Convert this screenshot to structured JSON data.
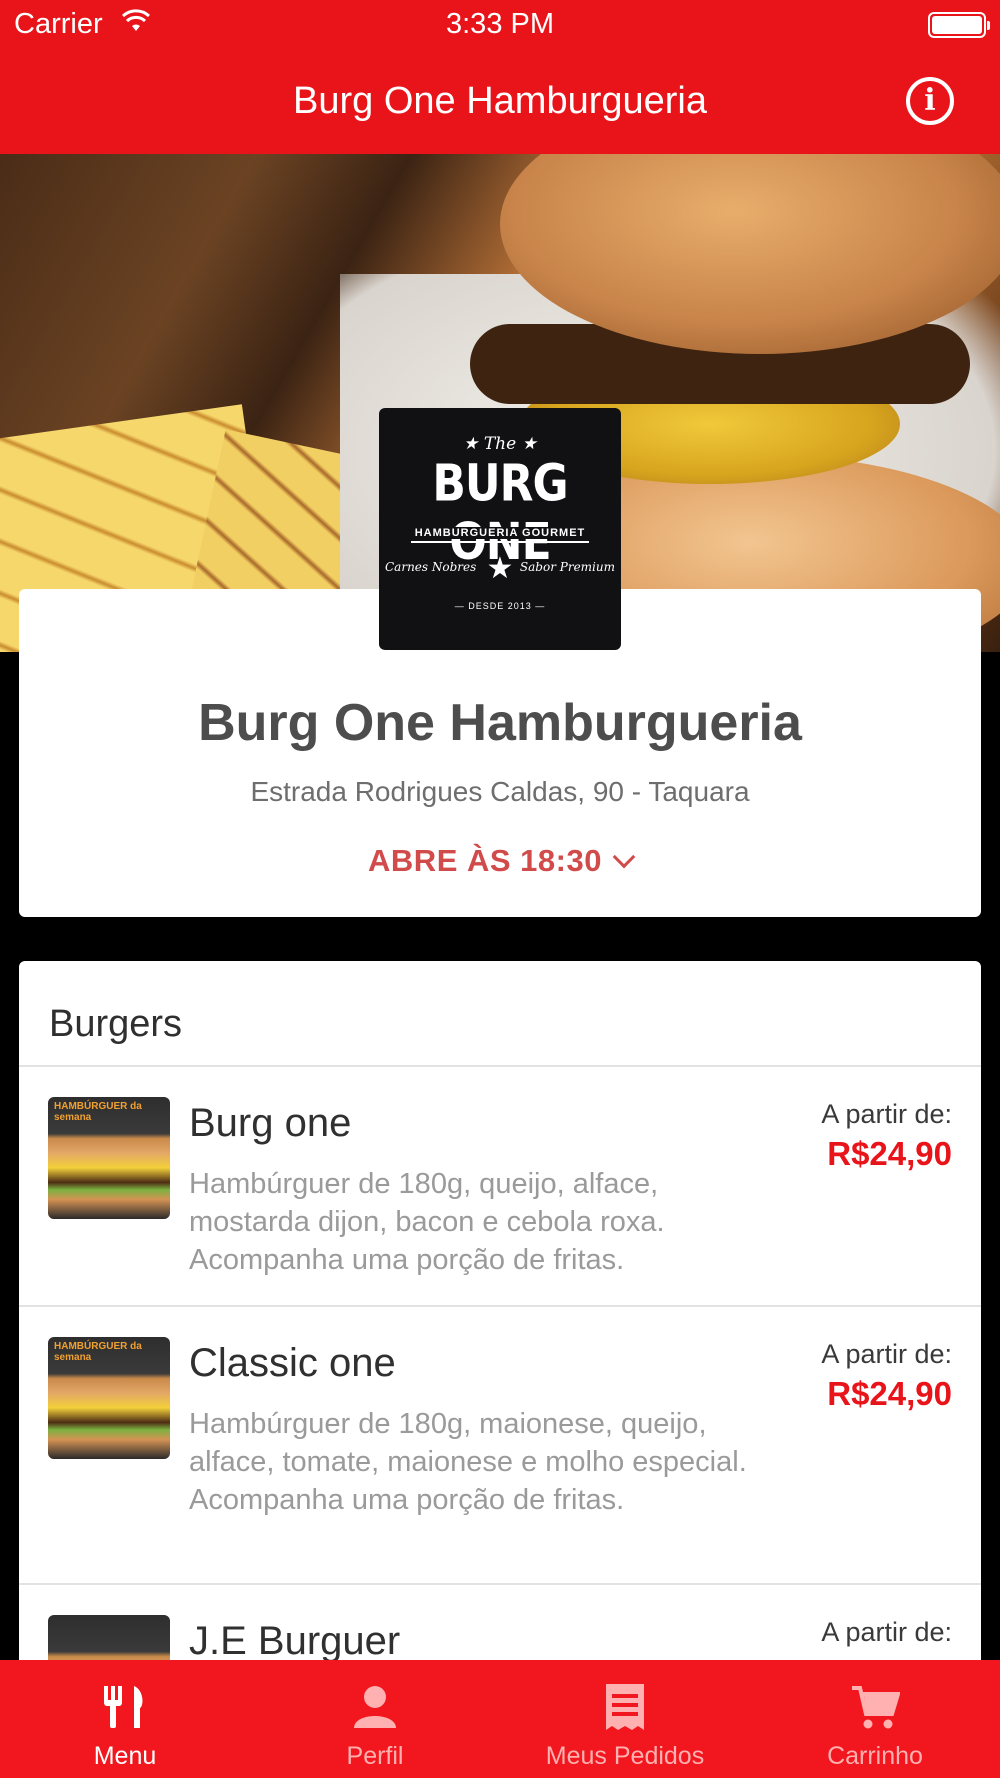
{
  "status_bar": {
    "carrier": "Carrier",
    "time": "3:33 PM"
  },
  "nav": {
    "title": "Burg One Hamburgueria",
    "info_icon": "info-icon"
  },
  "logo": {
    "the": "★ The ★",
    "name": "BURG ONE",
    "subtitle": "HAMBURGUERIA GOURMET",
    "left_text": "Carnes Nobres",
    "right_text": "Sabor Premium",
    "since": "— DESDE 2013 —"
  },
  "restaurant": {
    "name": "Burg One Hamburgueria",
    "address": "Estrada Rodrigues Caldas, 90 - Taquara",
    "hours": "ABRE ÀS 18:30"
  },
  "menu": {
    "section": "Burgers",
    "items": [
      {
        "name": "Burg one",
        "description": "Hambúrguer de 180g, queijo, alface, mostarda dijon, bacon e cebola roxa. Acompanha uma porção de fritas.",
        "from_label": "A partir de:",
        "price": "R$24,90",
        "thumb_tag": "HAMBÚRGUER da semana"
      },
      {
        "name": "Classic one",
        "description": "Hambúrguer de 180g, maionese, queijo, alface, tomate, maionese e molho especial. Acompanha uma porção de fritas.",
        "from_label": "A partir de:",
        "price": "R$24,90",
        "thumb_tag": "HAMBÚRGUER da semana"
      },
      {
        "name": "J.E Burguer",
        "description": "",
        "from_label": "A partir de:",
        "price": "",
        "thumb_tag": ""
      }
    ]
  },
  "tabs": [
    {
      "label": "Menu",
      "icon": "fork-knife-icon",
      "active": true
    },
    {
      "label": "Perfil",
      "icon": "person-icon",
      "active": false
    },
    {
      "label": "Meus Pedidos",
      "icon": "receipt-icon",
      "active": false
    },
    {
      "label": "Carrinho",
      "icon": "cart-icon",
      "active": false
    }
  ],
  "colors": {
    "brand_red": "#e8141a",
    "hours_red": "#d14b4b",
    "tab_red": "#f2171e"
  }
}
